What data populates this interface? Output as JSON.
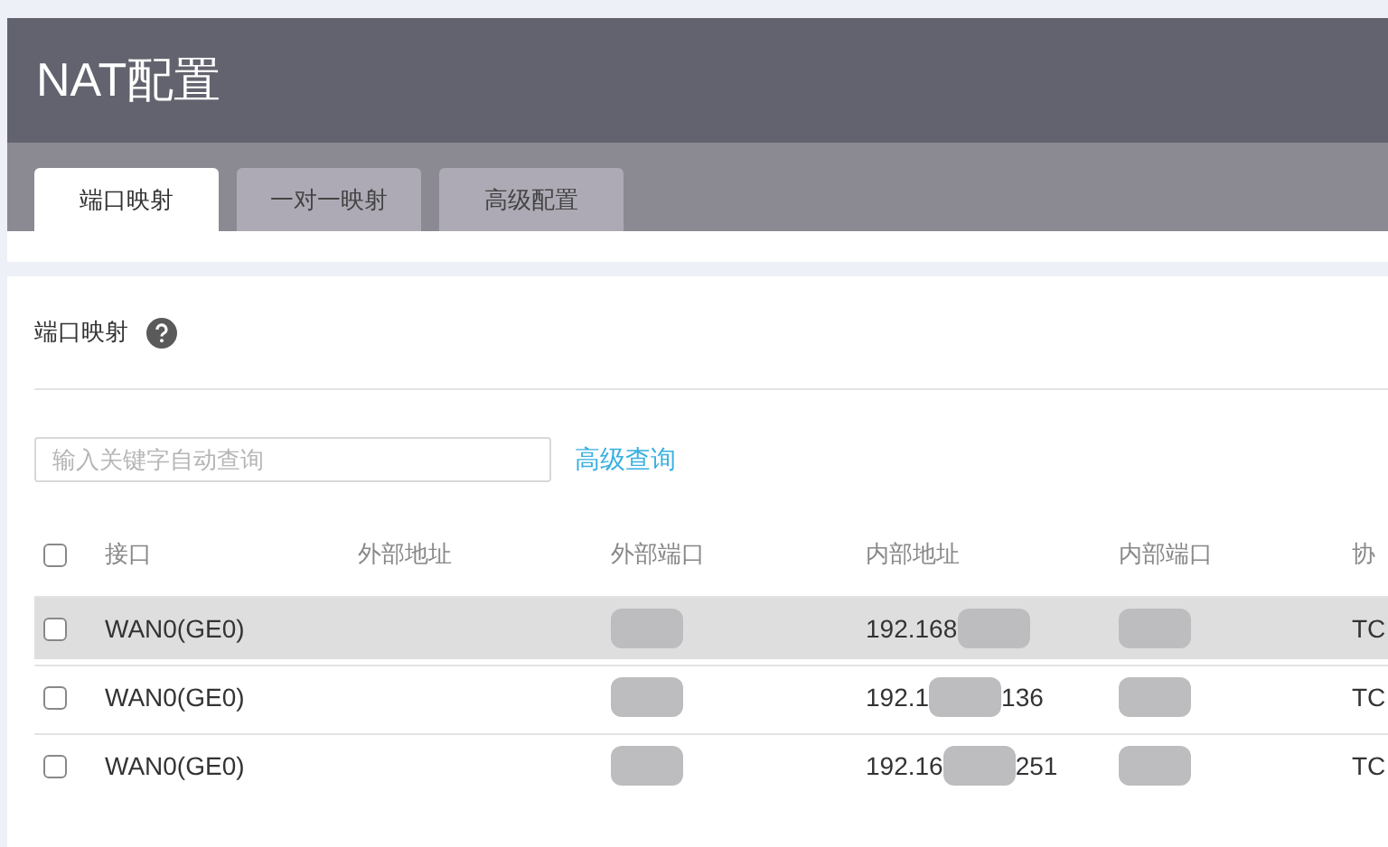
{
  "page": {
    "title": "NAT配置"
  },
  "tabs": [
    {
      "label": "端口映射",
      "selected": true
    },
    {
      "label": "一对一映射",
      "selected": false
    },
    {
      "label": "高级配置",
      "selected": false
    }
  ],
  "section": {
    "title": "端口映射"
  },
  "search": {
    "placeholder": "输入关键字自动查询",
    "link": "高级查询"
  },
  "table": {
    "header_checkbox": {
      "checked": false
    },
    "columns": [
      "接口",
      "外部地址",
      "外部端口",
      "内部地址",
      "内部端口",
      "协"
    ],
    "rows": [
      {
        "selected": true,
        "checked": false,
        "cells": [
          {
            "parts": [
              "WAN0(GE0)"
            ],
            "redacted": false
          },
          {
            "redacted": false
          },
          {
            "redacted": true
          },
          {
            "parts": [
              "192.168"
            ],
            "redacted": true
          },
          {
            "redacted": true
          },
          {
            "parts": [
              "TC"
            ],
            "redacted": false
          }
        ]
      },
      {
        "selected": false,
        "checked": false,
        "cells": [
          {
            "parts": [
              "WAN0(GE0)"
            ],
            "redacted": false
          },
          {
            "redacted": false
          },
          {
            "redacted": true
          },
          {
            "parts": [
              "192.1",
              "136"
            ],
            "redacted": true
          },
          {
            "redacted": true
          },
          {
            "parts": [
              "TC"
            ],
            "redacted": false
          }
        ]
      },
      {
        "selected": false,
        "checked": false,
        "cells": [
          {
            "parts": [
              "WAN0(GE0)"
            ],
            "redacted": false
          },
          {
            "redacted": false
          },
          {
            "redacted": true
          },
          {
            "parts": [
              "192.16",
              "251"
            ],
            "redacted": true
          },
          {
            "redacted": true
          },
          {
            "parts": [
              "TC"
            ],
            "redacted": false
          }
        ]
      }
    ]
  }
}
